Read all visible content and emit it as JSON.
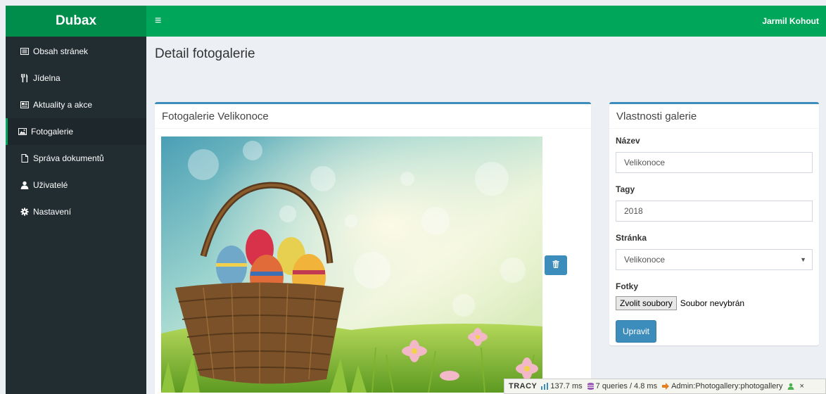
{
  "app": {
    "title": "Dubax",
    "user": "Jarmil Kohout"
  },
  "sidebar": {
    "items": [
      {
        "label": "Obsah stránek",
        "icon": "list-icon"
      },
      {
        "label": "Jídelna",
        "icon": "cutlery-icon"
      },
      {
        "label": "Aktuality a akce",
        "icon": "newspaper-icon"
      },
      {
        "label": "Fotogalerie",
        "icon": "image-icon",
        "active": true
      },
      {
        "label": "Správa dokumentů",
        "icon": "document-icon"
      },
      {
        "label": "Uživatelé",
        "icon": "user-icon"
      },
      {
        "label": "Nastavení",
        "icon": "gear-icon"
      }
    ]
  },
  "page": {
    "title": "Detail fotogalerie"
  },
  "gallery": {
    "title": "Fotogalerie Velikonoce"
  },
  "properties": {
    "title": "Vlastnosti galerie",
    "name_label": "Název",
    "name_value": "Velikonoce",
    "tags_label": "Tagy",
    "tags_value": "2018",
    "page_label": "Stránka",
    "page_value": "Velikonoce",
    "photos_label": "Fotky",
    "file_button": "Zvolit soubory",
    "file_status": "Soubor nevybrán",
    "submit": "Upravit"
  },
  "tracy": {
    "logo": "TRACY",
    "time": "137.7 ms",
    "queries": "7 queries / 4.8 ms",
    "route": "Admin:Photogallery:photogallery",
    "close": "×"
  },
  "colors": {
    "brand": "#00a65a",
    "brand_dark": "#008d4c",
    "sidebar": "#222d32",
    "primary": "#3c8dbc"
  }
}
